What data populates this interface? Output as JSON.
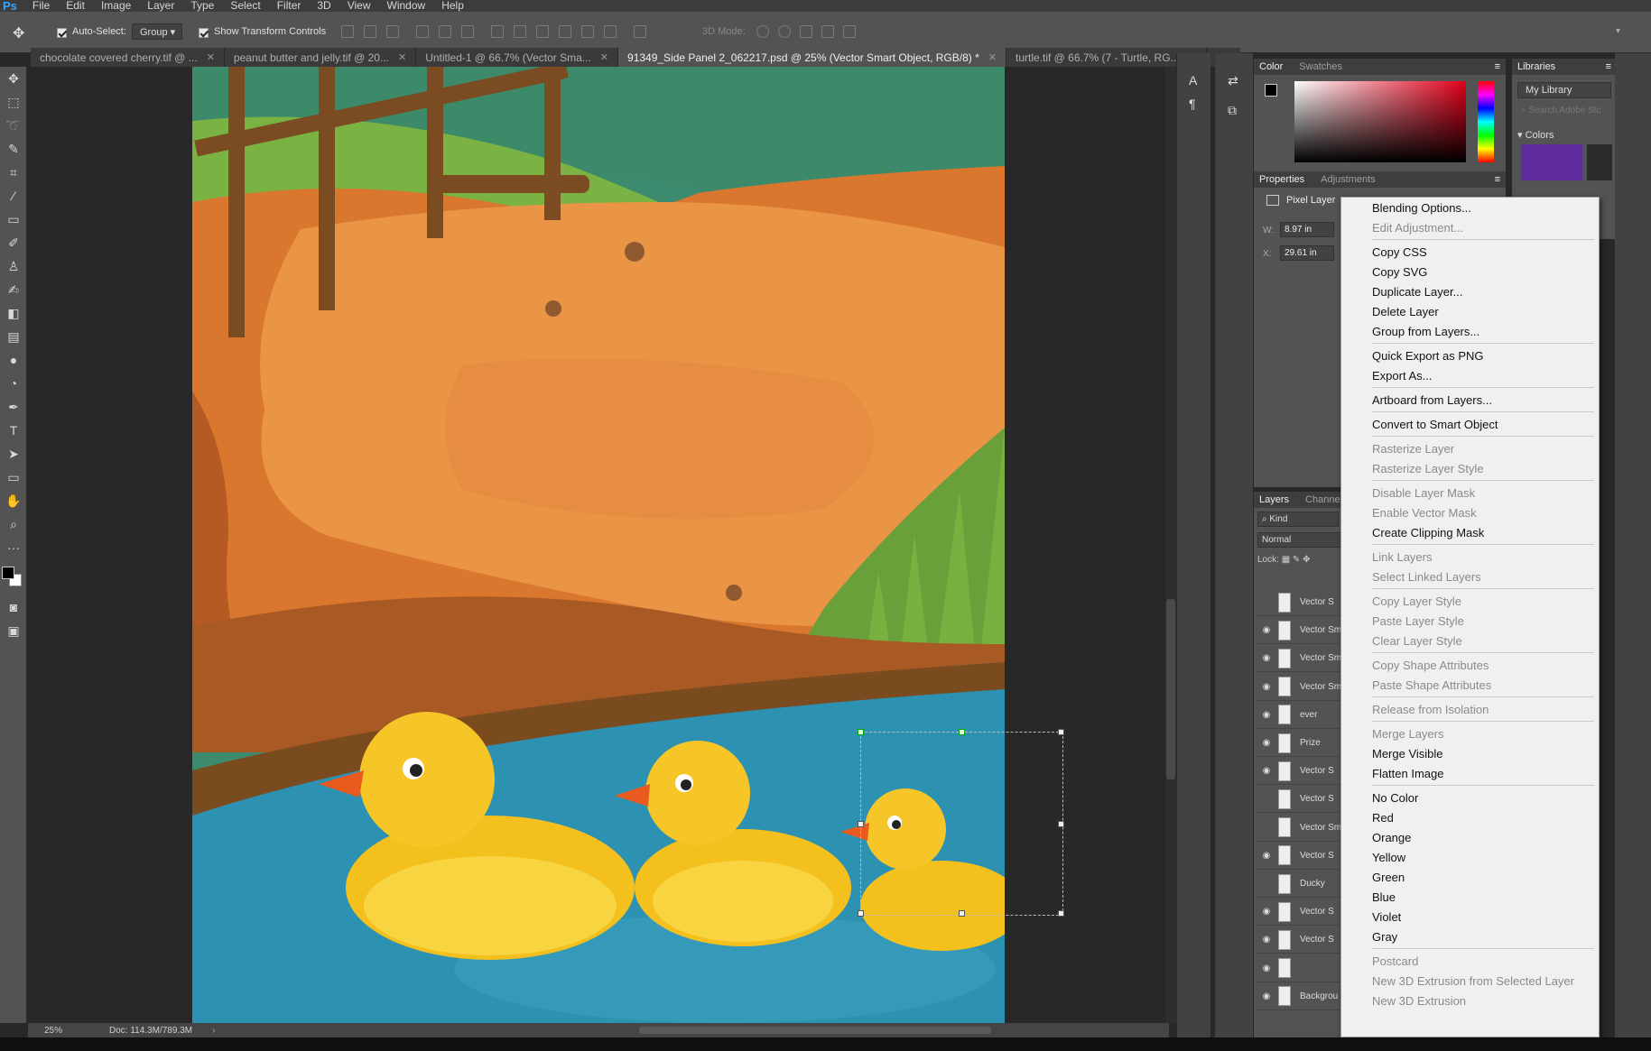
{
  "app": {
    "logo": "Ps"
  },
  "menu": [
    "File",
    "Edit",
    "Image",
    "Layer",
    "Type",
    "Select",
    "Filter",
    "3D",
    "View",
    "Window",
    "Help"
  ],
  "options": {
    "auto_select_label": "Auto-Select:",
    "auto_select_value": "Group",
    "show_transform_label": "Show Transform Controls",
    "mode_label": "3D Mode:"
  },
  "tabs": [
    {
      "label": "chocolate covered cherry.tif @ ...",
      "active": false
    },
    {
      "label": "peanut butter and jelly.tif @ 20...",
      "active": false
    },
    {
      "label": "Untitled-1 @ 66.7% (Vector Sma...",
      "active": false
    },
    {
      "label": "91349_Side Panel 2_062217.psd @ 25% (Vector Smart Object, RGB/8) *",
      "active": true
    },
    {
      "label": "turtle.tif @ 66.7% (7 - Turtle, RG...",
      "active": false
    }
  ],
  "status": {
    "zoom": "25%",
    "doc": "Doc: 114.3M/789.3M"
  },
  "panels": {
    "color_tab": "Color",
    "swatches_tab": "Swatches",
    "libraries_tab": "Libraries",
    "library_select": "My Library",
    "library_search": "Search Adobe Stc",
    "colors_section": "Colors",
    "properties_tab": "Properties",
    "adjustments_tab": "Adjustments",
    "pixel_layer": "Pixel Layer",
    "w_label": "W:",
    "w_value": "8.97 in",
    "x_label": "X:",
    "x_value": "29.61 in",
    "layers_tab": "Layers",
    "channels_tab": "Channels",
    "kind": "Kind",
    "blend_mode": "Normal",
    "lock_label": "Lock:"
  },
  "layers": [
    {
      "name": "Vector S",
      "visible": false
    },
    {
      "name": "Vector Sm",
      "visible": true
    },
    {
      "name": "Vector Sm",
      "visible": true
    },
    {
      "name": "Vector Sm",
      "visible": true
    },
    {
      "name": "ever",
      "visible": true
    },
    {
      "name": "Prize",
      "visible": true
    },
    {
      "name": "Vector S",
      "visible": true
    },
    {
      "name": "Vector S",
      "visible": false
    },
    {
      "name": "Vector Sm",
      "visible": false
    },
    {
      "name": "Vector S",
      "visible": true
    },
    {
      "name": "Ducky",
      "visible": false
    },
    {
      "name": "Vector S",
      "visible": true
    },
    {
      "name": "Vector S",
      "visible": true
    },
    {
      "name": "",
      "visible": true
    },
    {
      "name": "Backgrou",
      "visible": true
    }
  ],
  "context_menu": [
    {
      "label": "Blending Options...",
      "enabled": true
    },
    {
      "label": "Edit Adjustment...",
      "enabled": false
    },
    {
      "sep": true
    },
    {
      "label": "Copy CSS",
      "enabled": true
    },
    {
      "label": "Copy SVG",
      "enabled": true
    },
    {
      "label": "Duplicate Layer...",
      "enabled": true
    },
    {
      "label": "Delete Layer",
      "enabled": true
    },
    {
      "label": "Group from Layers...",
      "enabled": true
    },
    {
      "sep": true
    },
    {
      "label": "Quick Export as PNG",
      "enabled": true
    },
    {
      "label": "Export As...",
      "enabled": true
    },
    {
      "sep": true
    },
    {
      "label": "Artboard from Layers...",
      "enabled": true
    },
    {
      "sep": true
    },
    {
      "label": "Convert to Smart Object",
      "enabled": true
    },
    {
      "sep": true
    },
    {
      "label": "Rasterize Layer",
      "enabled": false
    },
    {
      "label": "Rasterize Layer Style",
      "enabled": false
    },
    {
      "sep": true
    },
    {
      "label": "Disable Layer Mask",
      "enabled": false
    },
    {
      "label": "Enable Vector Mask",
      "enabled": false
    },
    {
      "label": "Create Clipping Mask",
      "enabled": true
    },
    {
      "sep": true
    },
    {
      "label": "Link Layers",
      "enabled": false
    },
    {
      "label": "Select Linked Layers",
      "enabled": false
    },
    {
      "sep": true
    },
    {
      "label": "Copy Layer Style",
      "enabled": false
    },
    {
      "label": "Paste Layer Style",
      "enabled": false
    },
    {
      "label": "Clear Layer Style",
      "enabled": false
    },
    {
      "sep": true
    },
    {
      "label": "Copy Shape Attributes",
      "enabled": false
    },
    {
      "label": "Paste Shape Attributes",
      "enabled": false
    },
    {
      "sep": true
    },
    {
      "label": "Release from Isolation",
      "enabled": false
    },
    {
      "sep": true
    },
    {
      "label": "Merge Layers",
      "enabled": false
    },
    {
      "label": "Merge Visible",
      "enabled": true
    },
    {
      "label": "Flatten Image",
      "enabled": true
    },
    {
      "sep": true
    },
    {
      "label": "No Color",
      "enabled": true
    },
    {
      "label": "Red",
      "enabled": true
    },
    {
      "label": "Orange",
      "enabled": true
    },
    {
      "label": "Yellow",
      "enabled": true
    },
    {
      "label": "Green",
      "enabled": true
    },
    {
      "label": "Blue",
      "enabled": true
    },
    {
      "label": "Violet",
      "enabled": true
    },
    {
      "label": "Gray",
      "enabled": true
    },
    {
      "sep": true
    },
    {
      "label": "Postcard",
      "enabled": false
    },
    {
      "label": "New 3D Extrusion from Selected Layer",
      "enabled": false
    },
    {
      "label": "New 3D Extrusion",
      "enabled": false
    }
  ],
  "tools": [
    "move-tool-icon",
    "marquee-tool-icon",
    "lasso-tool-icon",
    "quick-select-icon",
    "crop-tool-icon",
    "eyedropper-icon",
    "healing-brush-icon",
    "brush-tool-icon",
    "clone-stamp-icon",
    "history-brush-icon",
    "eraser-icon",
    "gradient-icon",
    "blur-icon",
    "dodge-icon",
    "pen-tool-icon",
    "type-tool-icon",
    "path-select-icon",
    "rectangle-tool-icon",
    "hand-tool-icon",
    "zoom-tool-icon",
    "more-tools-icon"
  ]
}
